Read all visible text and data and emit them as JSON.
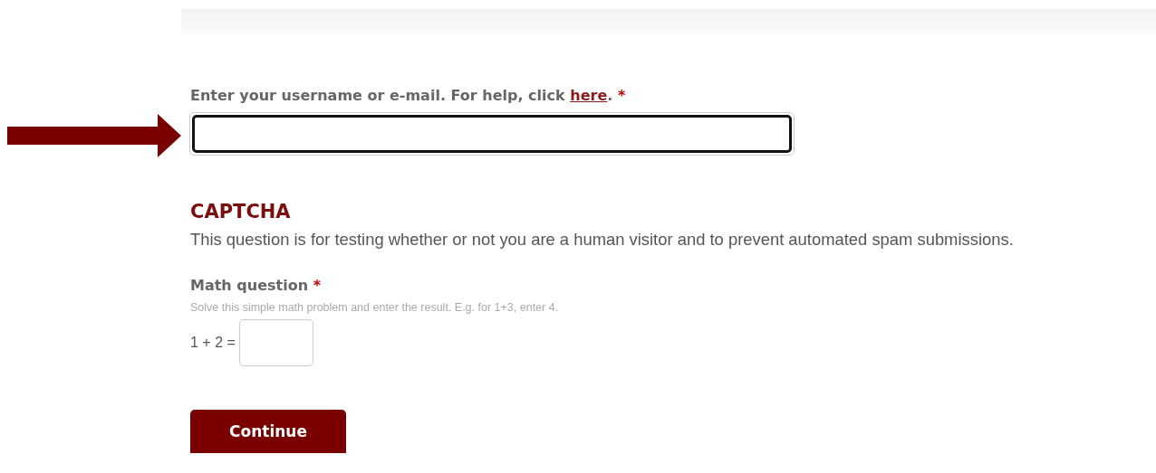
{
  "username": {
    "label": "Enter your username or e-mail. For help, click",
    "link": "here",
    "label_end": ".",
    "required": "*",
    "focused": true
  },
  "captcha": {
    "title": "CAPTCHA",
    "description": "This question is for testing whether or not you are a human visitor and to prevent automated spam submissions.",
    "question_label": "Math question",
    "required": "*",
    "hint": "Solve this simple math problem and enter the result. E.g. for 1+3, enter 4.",
    "equation": "1 + 2 ="
  },
  "buttons": [
    "Continue"
  ]
}
